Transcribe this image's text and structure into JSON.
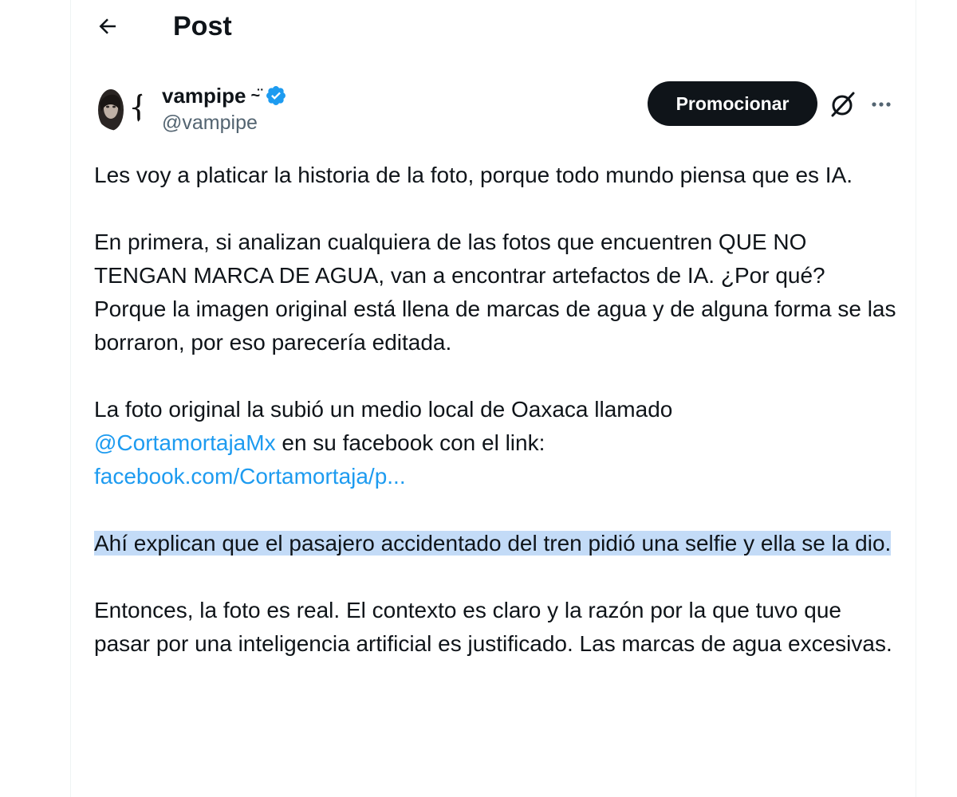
{
  "header": {
    "title": "Post",
    "back_icon": "arrow-left-icon"
  },
  "author": {
    "display_name": "vampipe",
    "name_suffix": "~̈",
    "handle": "@vampipe",
    "verified": true,
    "verified_color": "#1d9bf0"
  },
  "actions": {
    "promote_label": "Promocionar",
    "grok_icon": "grok-icon",
    "more_icon": "more-horizontal-icon"
  },
  "post": {
    "paragraph_1": "Les voy a platicar la historia de la foto, porque todo mundo piensa que es IA.",
    "paragraph_2": "En primera, si analizan cualquiera de las fotos que encuentren QUE NO TENGAN MARCA DE AGUA, van a encontrar artefactos de IA. ¿Por qué? Porque la imagen original está llena de marcas de agua y de alguna forma se las borraron, por eso parecería editada.",
    "paragraph_3_intro": "La foto original la subió un medio local de Oaxaca llamado",
    "paragraph_3_mention": "@CortamortajaMx",
    "paragraph_3_middle": " en su facebook con el link:",
    "paragraph_3_link": "facebook.com/Cortamortaja/p...",
    "paragraph_4_highlighted": "Ahí explican que el pasajero accidentado del tren pidió una selfie y ella se la dio.",
    "paragraph_5": "Entonces, la foto es real. El contexto es claro y la razón por la que tuvo que pasar por una inteligencia artificial es justificado. Las marcas de agua excesivas."
  },
  "colors": {
    "link": "#1d9bf0",
    "highlight": "#c3dbf7",
    "text": "#0f1419",
    "secondary_text": "#536471",
    "button_bg": "#0f1419"
  }
}
